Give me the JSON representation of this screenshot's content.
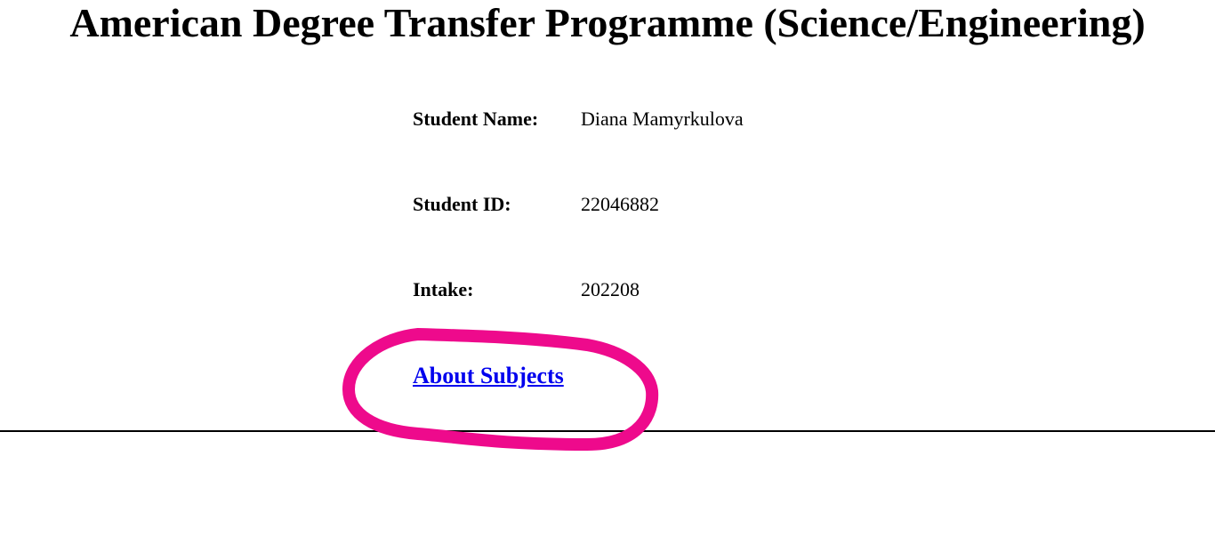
{
  "page": {
    "title": "American Degree Transfer Programme (Science/Engineering)"
  },
  "student": {
    "name_label": "Student Name:",
    "name_value": "Diana Mamyrkulova",
    "id_label": "Student ID:",
    "id_value": "22046882",
    "intake_label": "Intake:",
    "intake_value": "202208"
  },
  "links": {
    "about_subjects": "About Subjects"
  },
  "colors": {
    "link": "#0000ee",
    "annotation": "#ee0a8c",
    "text": "#000000",
    "background": "#ffffff"
  }
}
